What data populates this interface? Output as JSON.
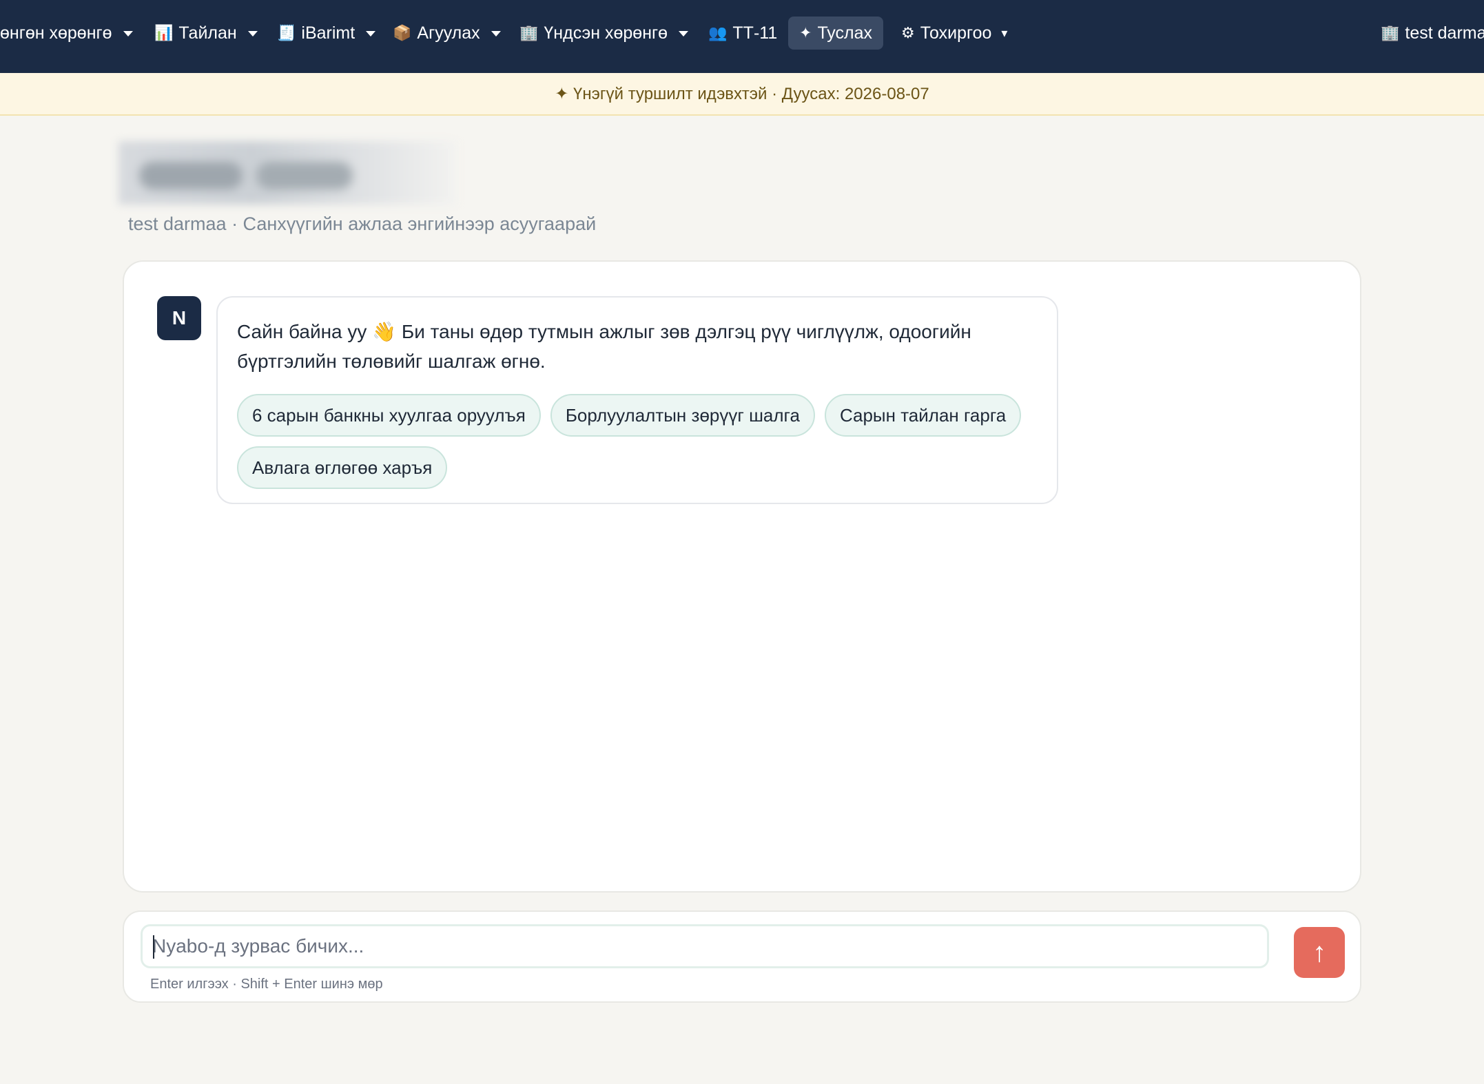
{
  "nav": {
    "items": [
      {
        "label": "ɵнгɵн хɵрɵнгɵ",
        "icon": "",
        "caret": true
      },
      {
        "label": "Тайлан",
        "icon": "📊",
        "caret": true
      },
      {
        "label": "iBarimt",
        "icon": "🧾",
        "caret": true
      },
      {
        "label": "Агуулах",
        "icon": "📦",
        "caret": true
      },
      {
        "label": "Үндсэн хөрөнгө",
        "icon": "🏢",
        "caret": true
      },
      {
        "label": "ТТ-11",
        "icon": "👥",
        "caret": false
      },
      {
        "label": "Туслах",
        "icon": "✦",
        "caret": false,
        "active": true
      },
      {
        "label": "Тохиргоо",
        "icon": "⚙",
        "caret": true
      }
    ],
    "company": {
      "icon": "🏢",
      "label": "test darma"
    }
  },
  "banner": {
    "text": "✦ Үнэгүй туршилт идэвхтэй · Дуусах: 2026-08-07"
  },
  "header": {
    "subtitle": "test darmaa · Санхүүгийн ажлаа энгийнээр асуугаарай"
  },
  "chat": {
    "assistant_avatar": "N",
    "greeting": "Сайн байна уу 👋 Би таны өдөр тутмын ажлыг зөв дэлгэц рүү чиглүүлж, одоогийн бүртгэлийн төлөвийг шалгаж өгнө.",
    "suggestions": [
      "6 сарын банкны хуулгаа оруулъя",
      "Борлуулалтын зөрүүг шалга",
      "Сарын тайлан гарга",
      "Авлага өглөгөө харъя"
    ]
  },
  "composer": {
    "placeholder": "Nyabo-д зурвас бичих...",
    "value": "",
    "send_icon": "↑",
    "hint": "Enter илгээх · Shift + Enter шинэ мөр"
  },
  "colors": {
    "nav_bg": "#1b2b45",
    "banner_bg": "#fdf6e3",
    "chip_bg": "#ecf6f3",
    "send_bg": "#e56b5d"
  }
}
